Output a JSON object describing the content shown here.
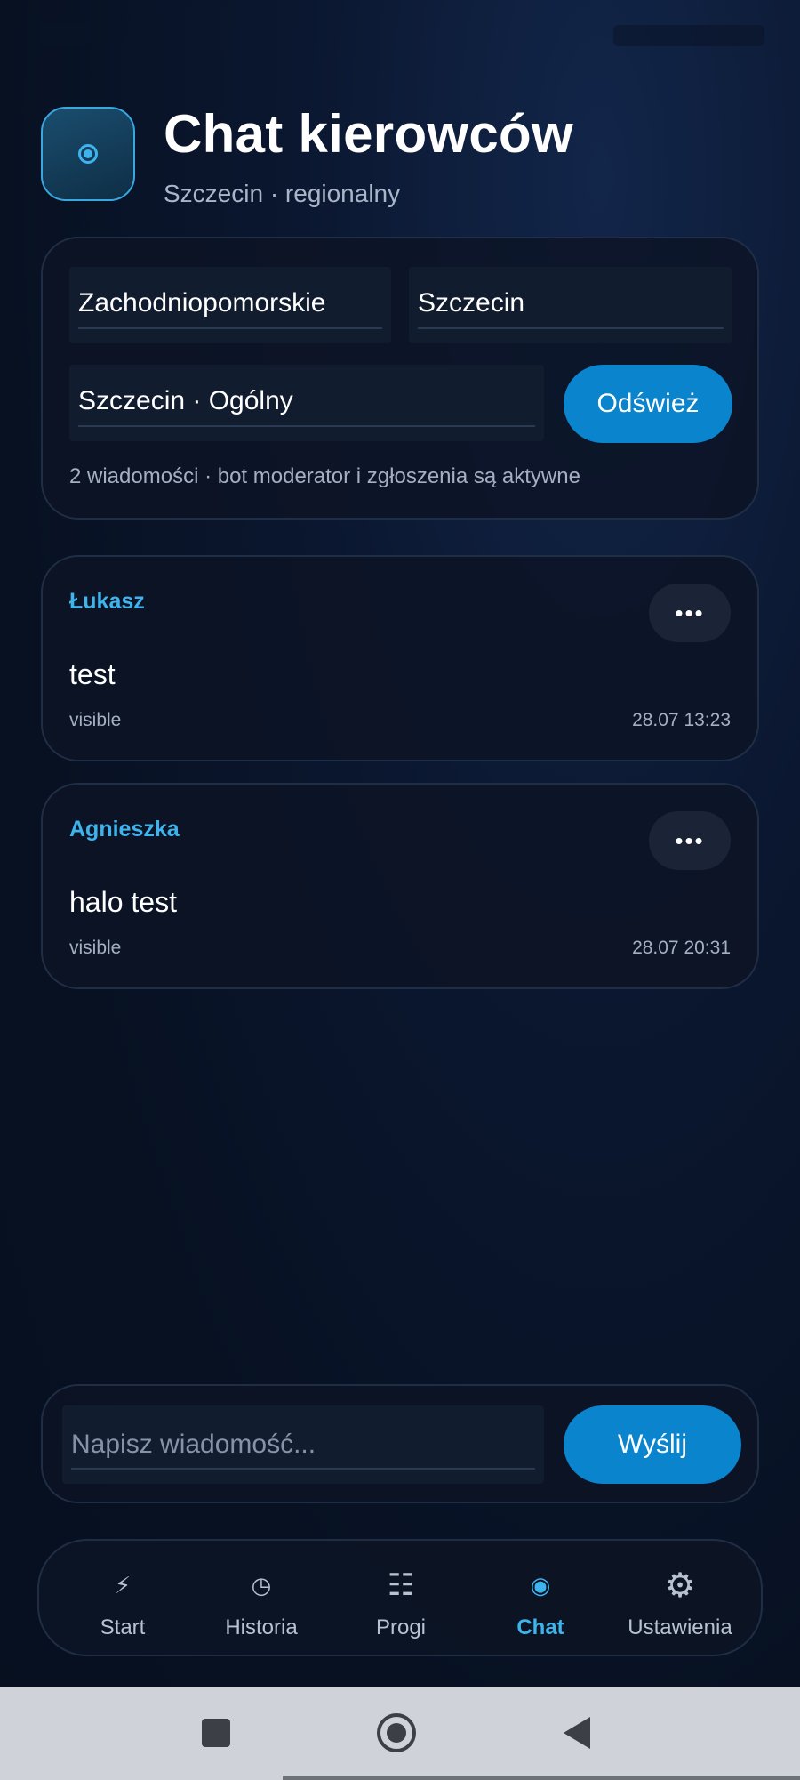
{
  "header": {
    "title": "Chat kierowców",
    "subtitle": "Szczecin · regionalny",
    "icon": "radio-dot-icon"
  },
  "filters": {
    "region": "Zachodniopomorskie",
    "city": "Szczecin",
    "channel": "Szczecin · Ogólny",
    "refresh_label": "Odśwież",
    "info": "2 wiadomości · bot moderator i zgłoszenia są aktywne"
  },
  "messages": [
    {
      "author": "Łukasz",
      "text": "test",
      "status": "visible",
      "time": "28.07 13:23",
      "more": "•••"
    },
    {
      "author": "Agnieszka",
      "text": "halo test",
      "status": "visible",
      "time": "28.07 20:31",
      "more": "•••"
    }
  ],
  "composer": {
    "placeholder": "Napisz wiadomość...",
    "send_label": "Wyślij"
  },
  "nav": {
    "items": [
      {
        "label": "Start",
        "icon": "lightning-icon",
        "glyph": "⚡"
      },
      {
        "label": "Historia",
        "icon": "clock-icon",
        "glyph": "◷"
      },
      {
        "label": "Progi",
        "icon": "list-icon",
        "glyph": "☷"
      },
      {
        "label": "Chat",
        "icon": "chat-dot-icon",
        "glyph": "◉"
      },
      {
        "label": "Ustawienia",
        "icon": "gear-icon",
        "glyph": "⚙"
      }
    ],
    "active": "Chat"
  },
  "colors": {
    "accent": "#0a84cc",
    "accent_text": "#3fb3ec",
    "background": "#071122"
  }
}
